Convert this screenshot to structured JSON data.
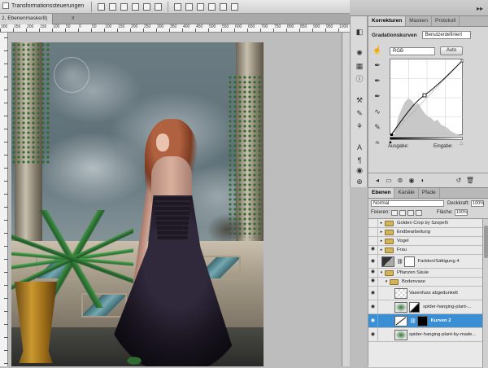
{
  "options_bar": {
    "transform_controls_label": "Transformationssteuerungen"
  },
  "document": {
    "tab_title": "2, Ebenenmaske/8)",
    "close_glyph": "x"
  },
  "ruler": {
    "ticks": [
      "300",
      "250",
      "200",
      "150",
      "100",
      "50",
      "0",
      "50",
      "100",
      "150",
      "200",
      "250",
      "300",
      "350",
      "400",
      "450",
      "500",
      "550",
      "600",
      "650",
      "700",
      "750",
      "800",
      "850",
      "900",
      "950",
      "1000"
    ]
  },
  "adjustments_panel": {
    "tabs": [
      "Korrekturen",
      "Masken",
      "Protokoll"
    ],
    "active_tab": "Korrekturen",
    "title": "Gradationskurven",
    "preset_value": "Benutzerdefiniert",
    "channel_value": "RGB",
    "auto_label": "Auto",
    "output_label": "Ausgabe:",
    "input_label": "Eingabe:"
  },
  "layers_panel": {
    "tabs": [
      "Ebenen",
      "Kanäle",
      "Pfade"
    ],
    "active_tab": "Ebenen",
    "blend_mode": "Normal",
    "opacity_label": "Deckkraft:",
    "opacity_value": "100%",
    "lock_label": "Fixieren:",
    "fill_label": "Fläche:",
    "fill_value": "100%",
    "layers": [
      {
        "name": "Golden Crop by SzopeN",
        "type": "group",
        "visible": false
      },
      {
        "name": "Endbearbeitung",
        "type": "group",
        "visible": false
      },
      {
        "name": "Vogel",
        "type": "group",
        "visible": false
      },
      {
        "name": "Frau",
        "type": "group",
        "visible": true
      },
      {
        "name": "Farbton/Sättigung 4",
        "type": "adjustment",
        "visible": true
      },
      {
        "name": "Pflanzen Säule",
        "type": "group",
        "visible": true
      },
      {
        "name": "Bodenvase",
        "type": "group",
        "visible": true
      },
      {
        "name": "Vasenfuss abgedunkelt",
        "type": "layer",
        "visible": true
      },
      {
        "name": "spider-hanging-plant-...",
        "type": "layer",
        "visible": true
      },
      {
        "name": "Kurven 2",
        "type": "adjustment",
        "visible": true,
        "selected": true
      },
      {
        "name": "spider-hanging-plant-by-made...",
        "type": "layer",
        "visible": true
      }
    ]
  },
  "colors": {
    "selection": "#3a8ed4",
    "panel_bg": "#d6d6d6",
    "canvas_bg": "#bdbdbd"
  }
}
